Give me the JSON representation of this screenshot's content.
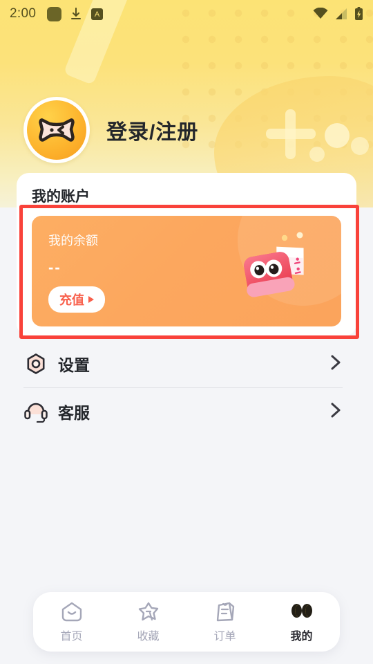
{
  "statusbar": {
    "time": "2:00",
    "left_icons": [
      "app-square-icon",
      "download-icon",
      "a-badge-icon"
    ],
    "right_icons": [
      "wifi-icon",
      "signal-icon",
      "battery-charging-icon"
    ]
  },
  "header": {
    "avatar_icon": "gamepad-avatar-icon",
    "login_text": "登录/注册"
  },
  "account": {
    "title": "我的账户",
    "balance": {
      "label": "我的余额",
      "value": "--",
      "recharge_label": "充值",
      "arrow_icon": "triangle-right-icon",
      "illustration": "wallet-character-icon",
      "card_color": "#FCA75E"
    },
    "highlight_color": "#F9423A"
  },
  "menu": {
    "items": [
      {
        "label": "设置",
        "icon": "hex-gear-icon",
        "chevron": "chevron-right-icon"
      },
      {
        "label": "客服",
        "icon": "headset-icon",
        "chevron": "chevron-right-icon"
      }
    ]
  },
  "bottom_nav": {
    "tabs": [
      {
        "label": "首页",
        "icon": "home-icon",
        "active": false
      },
      {
        "label": "收藏",
        "icon": "star-icon",
        "active": false
      },
      {
        "label": "订单",
        "icon": "order-clipboard-icon",
        "active": false
      },
      {
        "label": "我的",
        "icon": "eyes-icon",
        "active": true
      }
    ],
    "active_color": "#F5CE46",
    "inactive_color": "#A5A7B8"
  },
  "theme": {
    "hero_gradient_top": "#FCE375",
    "page_background": "#F4F5F8",
    "accent_orange": "#FCA75E",
    "accent_red": "#F8604C"
  }
}
